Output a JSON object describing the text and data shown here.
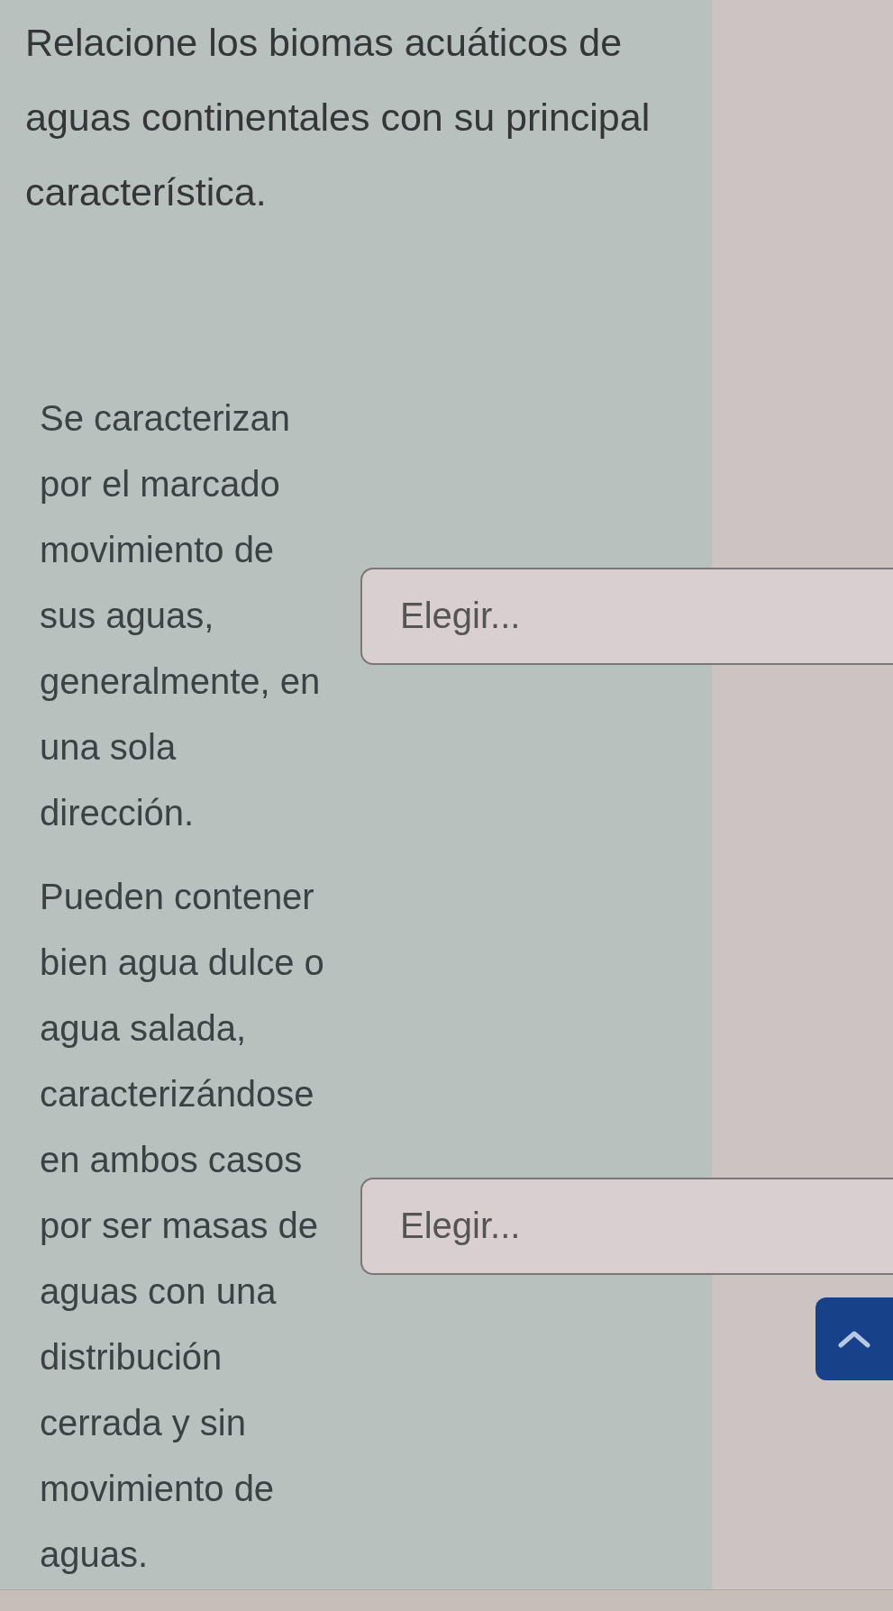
{
  "question": {
    "text": "Relacione los biomas acuáticos de aguas continentales con su principal característica."
  },
  "matches": [
    {
      "prompt": "Se caracterizan por el marcado movimiento de sus aguas, generalmente, en una sola dirección.",
      "dropdown": {
        "text": "Elegir..."
      }
    },
    {
      "prompt": "Pueden contener bien agua dulce o agua salada, caracterizándose en ambos casos por ser masas de aguas con una distribución cerrada y sin movimiento de aguas.",
      "dropdown": {
        "text": "Elegir..."
      }
    }
  ]
}
